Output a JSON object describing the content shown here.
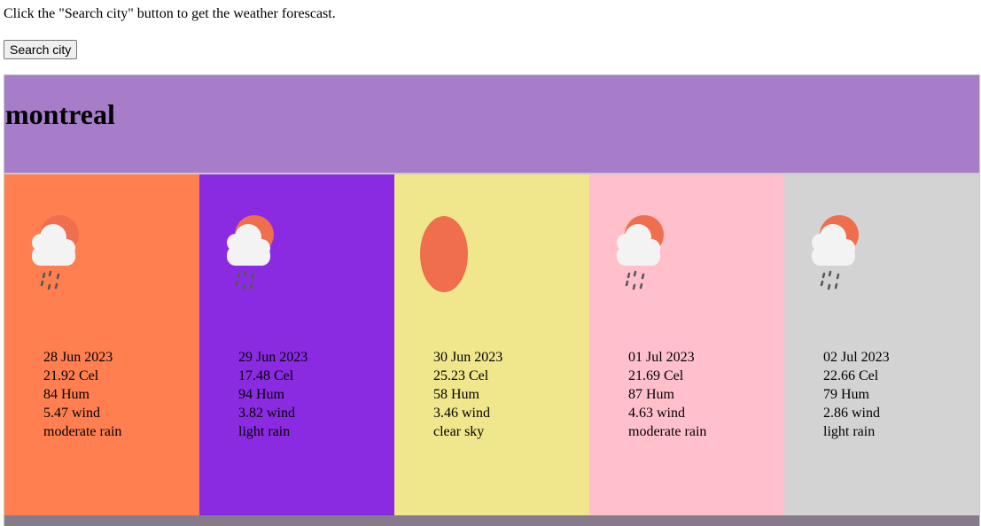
{
  "intro_text": "Click the \"Search city\" button to get the weather forescast.",
  "search_button_label": "Search city",
  "city": "montreal",
  "colors": {
    "header": "#a77dca",
    "footer": "#857b8b",
    "sun": "#ee6e4d",
    "cloud": "#f3f3f3",
    "rain": "#555555"
  },
  "days": [
    {
      "date": "28 Jun 2023",
      "temp": "21.92 Cel",
      "hum": "84 Hum",
      "wind": "5.47 wind",
      "desc": "moderate rain",
      "icon": "rain-cloud-sun-icon",
      "bg": "#ff7f50"
    },
    {
      "date": "29 Jun 2023",
      "temp": "17.48 Cel",
      "hum": "94 Hum",
      "wind": "3.82 wind",
      "desc": "light rain",
      "icon": "rain-cloud-sun-icon",
      "bg": "#8a2be2"
    },
    {
      "date": "30 Jun 2023",
      "temp": "25.23 Cel",
      "hum": "58 Hum",
      "wind": "3.46 wind",
      "desc": "clear sky",
      "icon": "sun-icon",
      "bg": "#f0e68c"
    },
    {
      "date": "01 Jul 2023",
      "temp": "21.69 Cel",
      "hum": "87 Hum",
      "wind": "4.63 wind",
      "desc": "moderate rain",
      "icon": "rain-cloud-sun-icon",
      "bg": "#ffc0cb"
    },
    {
      "date": "02 Jul 2023",
      "temp": "22.66 Cel",
      "hum": "79 Hum",
      "wind": "2.86 wind",
      "desc": "light rain",
      "icon": "rain-cloud-sun-icon",
      "bg": "#d3d3d3"
    }
  ]
}
